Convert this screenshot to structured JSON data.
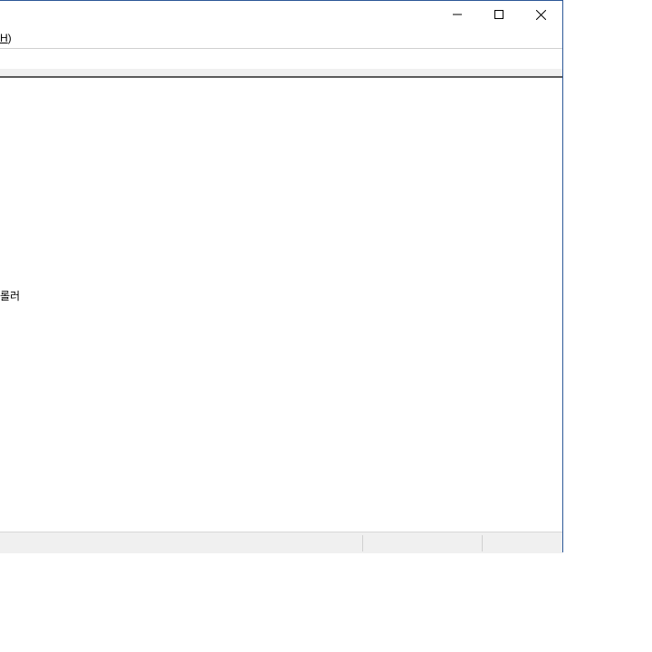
{
  "menubar": {
    "help_label": "H",
    "help_suffix": ")"
  },
  "content": {
    "partial_item": "롤러"
  },
  "caption": {
    "minimize_icon": "minimize-icon",
    "maximize_icon": "maximize-icon",
    "close_icon": "close-icon"
  },
  "colors": {
    "window_border": "#2b5797",
    "status_bg": "#f0f0f0"
  }
}
